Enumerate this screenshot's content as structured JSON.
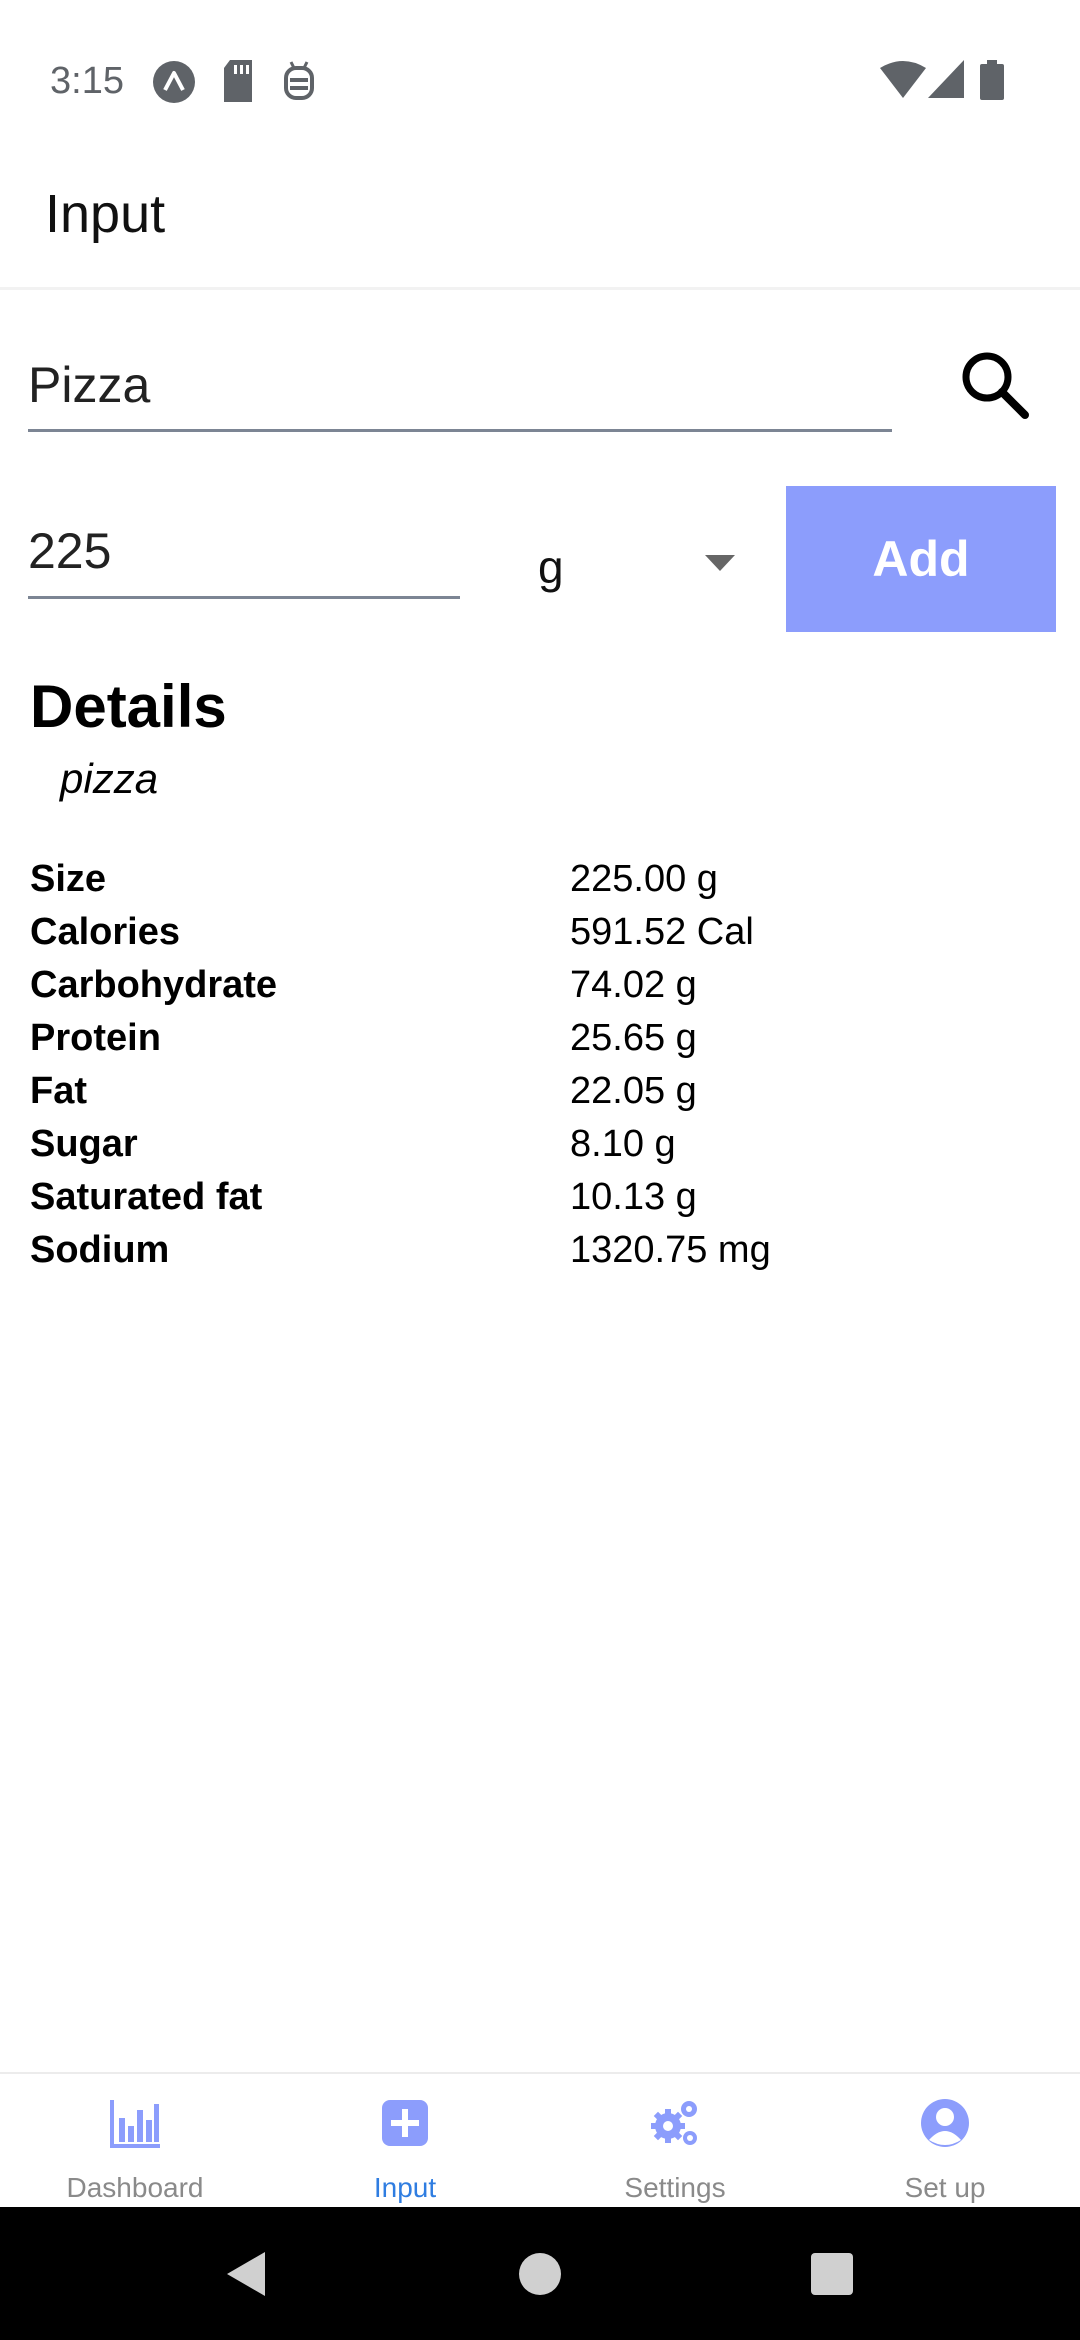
{
  "status_bar": {
    "time": "3:15",
    "icons": [
      "app-notification-icon",
      "sd-card-icon",
      "android-debug-icon",
      "wifi-icon",
      "cell-signal-icon",
      "battery-icon"
    ]
  },
  "app_bar": {
    "title": "Input"
  },
  "search": {
    "value": "Pizza",
    "icon": "search-icon"
  },
  "amount": {
    "value": "225",
    "unit": "g",
    "add_label": "Add",
    "add_color": "#8c9dfc"
  },
  "details": {
    "title": "Details",
    "food_name": "pizza",
    "rows": [
      {
        "label": "Size",
        "value": "225.00 g"
      },
      {
        "label": "Calories",
        "value": "591.52 Cal"
      },
      {
        "label": "Carbohydrate",
        "value": "74.02 g"
      },
      {
        "label": "Protein",
        "value": "25.65 g"
      },
      {
        "label": "Fat",
        "value": "22.05 g"
      },
      {
        "label": "Sugar",
        "value": "8.10 g"
      },
      {
        "label": "Saturated fat",
        "value": "10.13 g"
      },
      {
        "label": "Sodium",
        "value": "1320.75 mg"
      }
    ]
  },
  "bottom_nav": {
    "active_color": "#2f7de1",
    "icon_color": "#8c9dfc",
    "items": [
      {
        "label": "Dashboard",
        "icon": "bar-chart-icon"
      },
      {
        "label": "Input",
        "icon": "plus-square-icon",
        "active": true
      },
      {
        "label": "Settings",
        "icon": "gears-icon"
      },
      {
        "label": "Set up",
        "icon": "user-circle-icon"
      }
    ]
  },
  "system_nav": {
    "icons": [
      "back-icon",
      "home-icon",
      "recents-icon"
    ]
  }
}
